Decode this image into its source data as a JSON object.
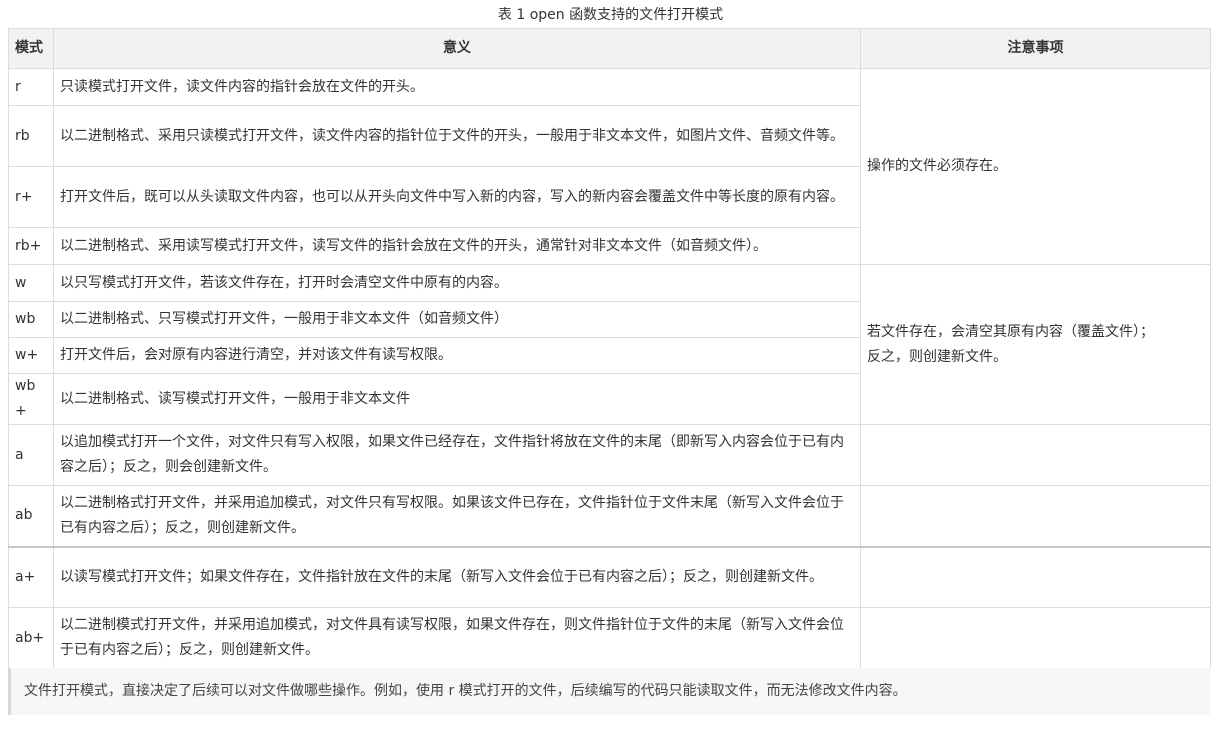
{
  "caption": "表 1 open 函数支持的文件打开模式",
  "headers": [
    "模式",
    "意义",
    "注意事项"
  ],
  "rows": [
    {
      "mode": "r",
      "meaning": "只读模式打开文件，读文件内容的指针会放在文件的开头。"
    },
    {
      "mode": "rb",
      "meaning": "以二进制格式、采用只读模式打开文件，读文件内容的指针位于文件的开头，一般用于非文本文件，如图片文件、音频文件等。"
    },
    {
      "mode": "r+",
      "meaning": "打开文件后，既可以从头读取文件内容，也可以从开头向文件中写入新的内容，写入的新内容会覆盖文件中等长度的原有内容。"
    },
    {
      "mode": "rb+",
      "meaning": "以二进制格式、采用读写模式打开文件，读写文件的指针会放在文件的开头，通常针对非文本文件（如音频文件）。"
    },
    {
      "mode": "w",
      "meaning": "以只写模式打开文件，若该文件存在，打开时会清空文件中原有的内容。"
    },
    {
      "mode": "wb",
      "meaning": "以二进制格式、只写模式打开文件，一般用于非文本文件（如音频文件）"
    },
    {
      "mode": "w+",
      "meaning": "打开文件后，会对原有内容进行清空，并对该文件有读写权限。"
    },
    {
      "mode": "wb+",
      "meaning": "以二进制格式、读写模式打开文件，一般用于非文本文件"
    },
    {
      "mode": "a",
      "meaning": "以追加模式打开一个文件，对文件只有写入权限，如果文件已经存在，文件指针将放在文件的末尾（即新写入内容会位于已有内容之后）；反之，则会创建新文件。"
    },
    {
      "mode": "ab",
      "meaning": "以二进制格式打开文件，并采用追加模式，对文件只有写权限。如果该文件已存在，文件指针位于文件末尾（新写入文件会位于已有内容之后）；反之，则创建新文件。"
    },
    {
      "mode": "a+",
      "meaning": "以读写模式打开文件；如果文件存在，文件指针放在文件的末尾（新写入文件会位于已有内容之后）；反之，则创建新文件。"
    },
    {
      "mode": "ab+",
      "meaning": "以二进制模式打开文件，并采用追加模式，对文件具有读写权限，如果文件存在，则文件指针位于文件的末尾（新写入文件会位于已有内容之后）；反之，则创建新文件。"
    }
  ],
  "notes": {
    "r_group": "操作的文件必须存在。",
    "w_group_line1": "若文件存在，会清空其原有内容（覆盖文件）；",
    "w_group_line2": "反之，则创建新文件。"
  },
  "tip": "文件打开模式，直接决定了后续可以对文件做哪些操作。例如，使用 r 模式打开的文件，后续编写的代码只能读取文件，而无法修改文件内容。"
}
